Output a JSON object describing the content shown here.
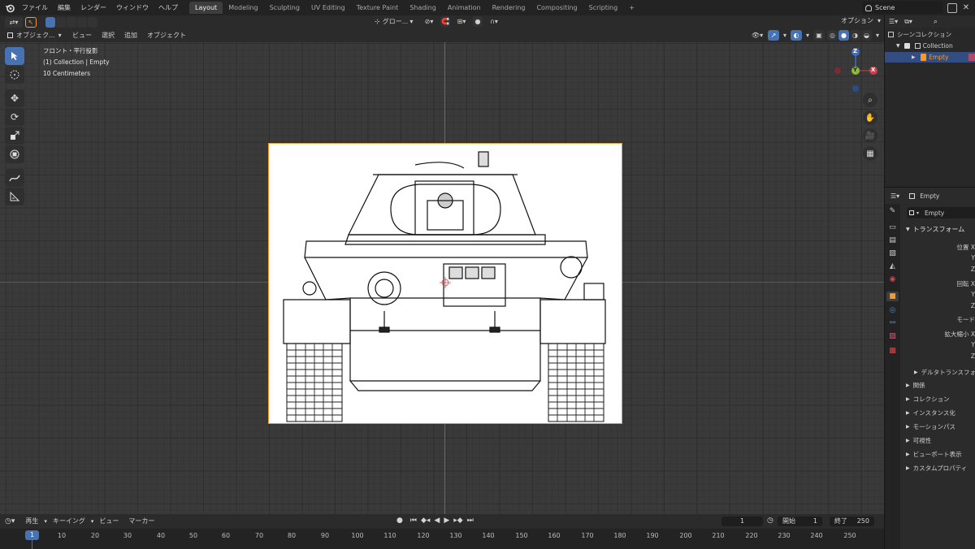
{
  "topbar": {
    "menus": [
      "ファイル",
      "編集",
      "レンダー",
      "ウィンドウ",
      "ヘルプ"
    ],
    "workspaces": [
      "Layout",
      "Modeling",
      "Sculpting",
      "UV Editing",
      "Texture Paint",
      "Shading",
      "Animation",
      "Rendering",
      "Compositing",
      "Scripting"
    ],
    "add_tab": "+",
    "scene": "Scene"
  },
  "toolheader": {
    "transform_orientation": "グロー...",
    "options": "オプション"
  },
  "viewport_header": {
    "mode": "オブジェク...",
    "menus": [
      "ビュー",
      "選択",
      "追加",
      "オブジェクト"
    ]
  },
  "viewport": {
    "view_name": "フロント・平行投影",
    "collection_info": "(1) Collection | Empty",
    "scale_info": "10 Centimeters",
    "gizmo": {
      "z": "Z",
      "y": "Y",
      "x": "X"
    },
    "colors": {
      "x_axis": "#9d3b45",
      "y_axis": "#6f9a2e",
      "z_axis": "#3a6ec9",
      "selection": "#f49b28",
      "active_tool": "#4772b3"
    }
  },
  "outliner": {
    "scene_collection": "シーンコレクション",
    "collection": "Collection",
    "object": "Empty"
  },
  "properties": {
    "object_name": "Empty",
    "object_field": "Empty",
    "sections": {
      "transform": "トランスフォーム",
      "location_x": "位置 X",
      "y1": "Y",
      "z1": "Z",
      "rotation_x": "回転 X",
      "y2": "Y",
      "z2": "Z",
      "mode": "モード",
      "scale_x": "拡大縮小 X",
      "y3": "Y",
      "z3": "Z",
      "delta": "デルタトランスフォーム"
    },
    "panels": [
      "関係",
      "コレクション",
      "インスタンス化",
      "モーションパス",
      "可視性",
      "ビューポート表示",
      "カスタムプロパティ"
    ]
  },
  "timeline": {
    "menus": [
      "再生",
      "キーイング",
      "ビュー",
      "マーカー"
    ],
    "current_frame": "1",
    "start_label": "開始",
    "start": "1",
    "end_label": "終了",
    "end": "250",
    "ruler": [
      "10",
      "20",
      "30",
      "40",
      "50",
      "60",
      "70",
      "80",
      "90",
      "100",
      "110",
      "120",
      "130",
      "140",
      "150",
      "160",
      "170",
      "180",
      "190",
      "200",
      "210",
      "220",
      "230",
      "240",
      "250"
    ],
    "playhead": "1"
  }
}
